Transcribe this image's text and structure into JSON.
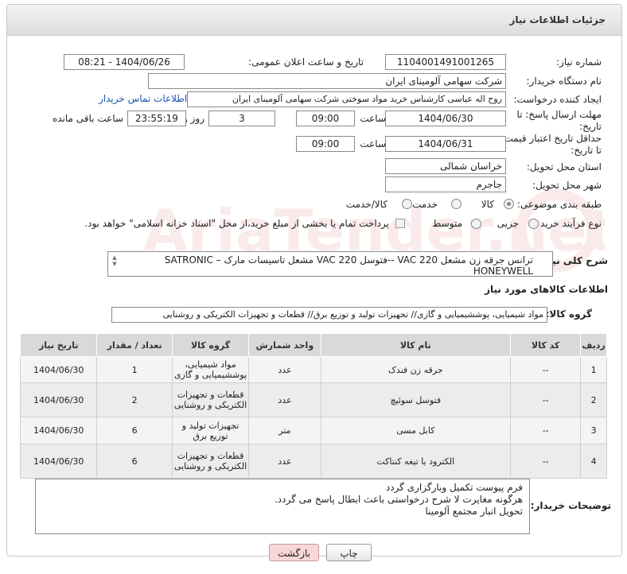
{
  "panel_title": "جزئیات اطلاعات نیاز",
  "fields": {
    "need_number_label": "شماره نیاز:",
    "need_number": "1104001491001265",
    "announce_label": "تاریخ و ساعت اعلان عمومی:",
    "announce_value": "1404/06/26 - 08:21",
    "buyer_label": "نام دستگاه خریدار:",
    "buyer_value": "شرکت سهامی آلومینای ایران",
    "creator_label": "ایجاد کننده درخواست:",
    "creator_value": "روح اله عباسی کارشناس خرید مواد سوختی شرکت سهامی آلومینای ایران",
    "contact_link": "اطلاعات تماس خریدار",
    "deadline_label": "مهلت ارسال پاسخ: تا تاریخ:",
    "deadline_date": "1404/06/30",
    "time_label": "ساعت",
    "deadline_time": "09:00",
    "days_value": "3",
    "days_label": "روز و",
    "remaining_time": "23:55:19",
    "remaining_label": "ساعت باقی مانده",
    "validity_label": "حداقل تاریخ اعتبار قیمت: تا تاریخ:",
    "validity_date": "1404/06/31",
    "validity_time": "09:00",
    "province_label": "استان محل تحویل:",
    "province_value": "خراسان شمالی",
    "city_label": "شهر محل تحویل:",
    "city_value": "جاجرم",
    "category_label": "طبقه بندی موضوعی:",
    "category_options": [
      "کالا",
      "خدمت",
      "کالا/خدمت"
    ],
    "process_label": "نوع فرآیند خرید :",
    "process_options": [
      "جزیی",
      "متوسط"
    ],
    "payment_note": "پرداخت تمام یا بخشی از مبلغ خرید،از محل \"اسناد خزانه اسلامی\" خواهد بود."
  },
  "description": {
    "label": "شرح کلی نیاز:",
    "value": "ترانس جرقه زن مشعل VAC 220 --فتوسل VAC 220 مشعل تاسیسات مارک SATRONIC – HONEYWELL"
  },
  "goods_section_title": "اطلاعات کالاهای مورد نیاز",
  "goods_group": {
    "label": "گروه کالا:",
    "value": "مواد شیمیایی، پوششیمیایی و  گازی// تجهیزات تولید و توزیع برق// قطعات و تجهیزات الکتریکی و روشنایی"
  },
  "table": {
    "headers": [
      "ردیف",
      "کد کالا",
      "نام کالا",
      "واحد شمارش",
      "گروه کالا",
      "تعداد / مقدار",
      "تاریخ نیاز"
    ],
    "rows": [
      [
        "1",
        "--",
        "جرقه زن فندک",
        "عدد",
        "مواد شیمیایی، پوششیمیایی و گازی",
        "1",
        "1404/06/30"
      ],
      [
        "2",
        "--",
        "فتوسل سوئیچ",
        "عدد",
        "قطعات و تجهیزات الکتریکی و روشنایی",
        "2",
        "1404/06/30"
      ],
      [
        "3",
        "--",
        "کابل مسی",
        "متر",
        "تجهیزات تولید و توزیع برق",
        "6",
        "1404/06/30"
      ],
      [
        "4",
        "--",
        "الکترود یا تیغه کنتاکت",
        "عدد",
        "قطعات و تجهیزات الکتریکی و روشنایی",
        "6",
        "1404/06/30"
      ]
    ]
  },
  "buyer_notes": {
    "label": "توضیحات خریدار:",
    "lines": [
      "فرم پیوست تکمیل وبارگزاری گردد",
      "هرگونه مغایرت لا شرح درخواستی باعث ابطال پاسخ می گردد.",
      "تحویل انبار مجتمع آلومینا"
    ]
  },
  "buttons": {
    "print": "چاپ",
    "back": "بازگشت"
  },
  "watermark_text": "AriaTender.net"
}
